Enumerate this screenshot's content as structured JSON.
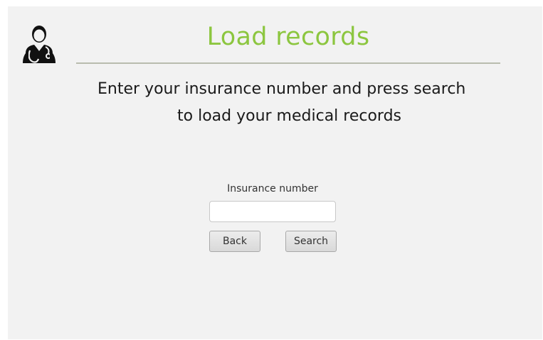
{
  "header": {
    "title": "Load records",
    "title_color": "#8cc63f",
    "icon": "doctor-icon"
  },
  "instructions": {
    "line1": "Enter your insurance number and press search",
    "line2": "to load your medical records"
  },
  "form": {
    "insurance_label": "Insurance number",
    "insurance_value": "",
    "insurance_placeholder": ""
  },
  "buttons": {
    "back_label": "Back",
    "search_label": "Search"
  }
}
